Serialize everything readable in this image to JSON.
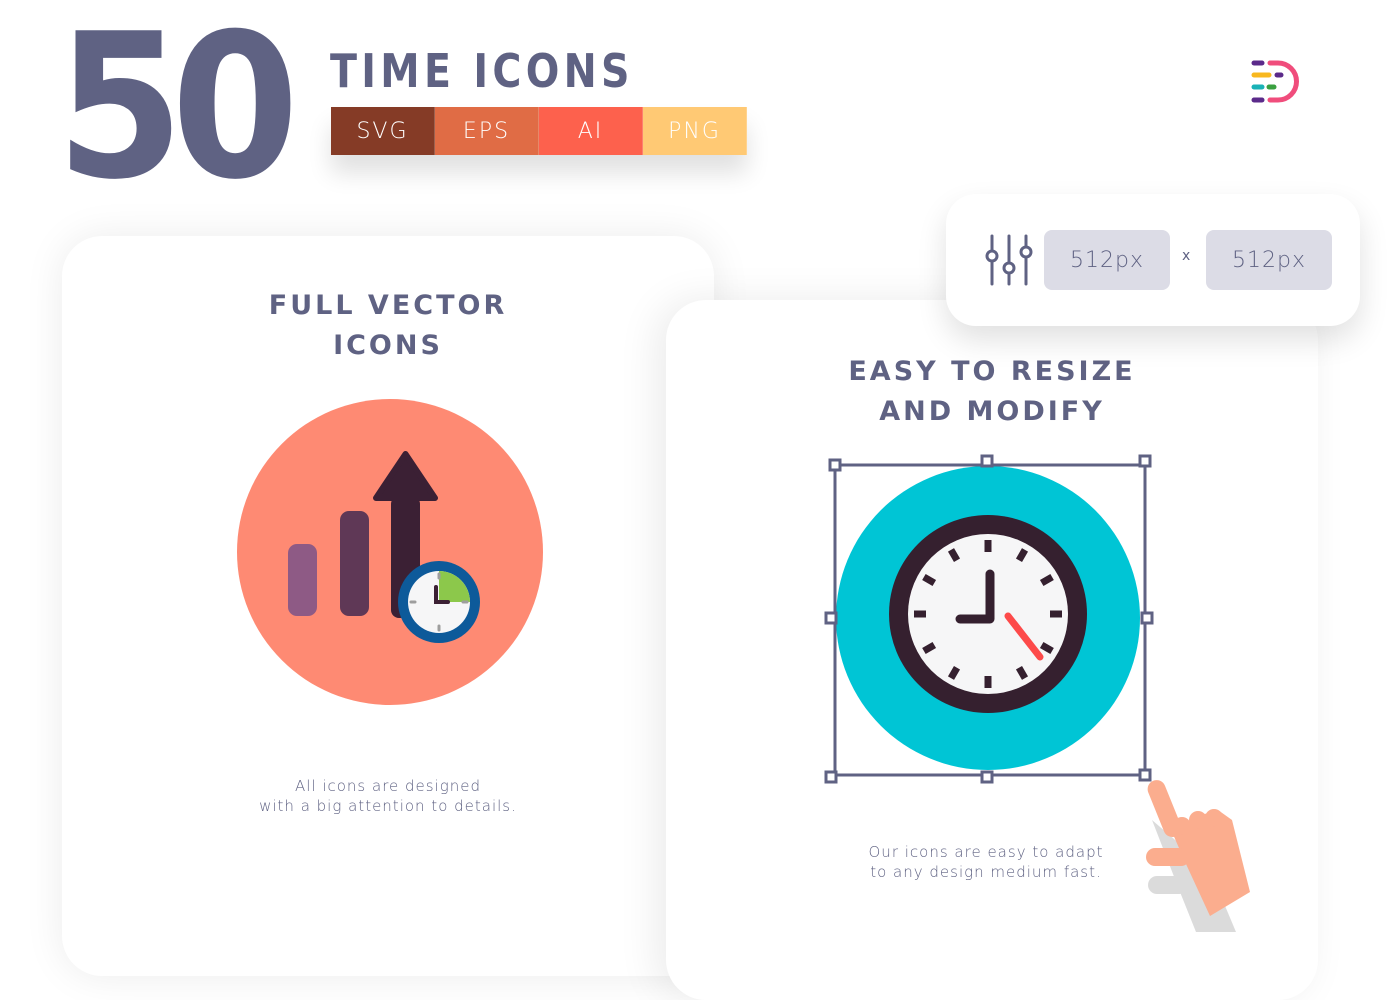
{
  "header": {
    "count": "50",
    "title": "TIME ICONS",
    "formats": [
      {
        "label": "SVG",
        "color": "#853b26"
      },
      {
        "label": "EPS",
        "color": "#e06c45"
      },
      {
        "label": "AI",
        "color": "#fd614d"
      },
      {
        "label": "PNG",
        "color": "#ffc974"
      }
    ],
    "logo_icon": "brand-logo-icon"
  },
  "resize_panel": {
    "icon": "sliders-icon",
    "width_value": "512px",
    "separator": "x",
    "height_value": "512px"
  },
  "cards": [
    {
      "title_lines": [
        "FULL VECTOR",
        "ICONS"
      ],
      "icon": "growth-chart-clock-icon",
      "description_lines": [
        "All icons are designed",
        "with a big attention to details."
      ],
      "colors": {
        "background": "#fe8a73",
        "bar1": "#8e5a85",
        "bar2": "#5f3856",
        "arrow": "#3b2034",
        "clock_ring": "#0d5a9a",
        "clock_fill": "#8cc84b"
      }
    },
    {
      "title_lines": [
        "EASY TO RESIZE",
        "AND MODIFY"
      ],
      "icon": "wall-clock-icon",
      "description_lines": [
        "Our icons are easy to adapt",
        "to any design medium fast."
      ],
      "colors": {
        "background": "#00c5d5",
        "rim": "#35202f",
        "face": "#f6f6f7",
        "second_hand": "#fd4a4a"
      }
    }
  ],
  "colors": {
    "primary_text": "#5f6283",
    "hand_cursor": "#fbad8e"
  }
}
